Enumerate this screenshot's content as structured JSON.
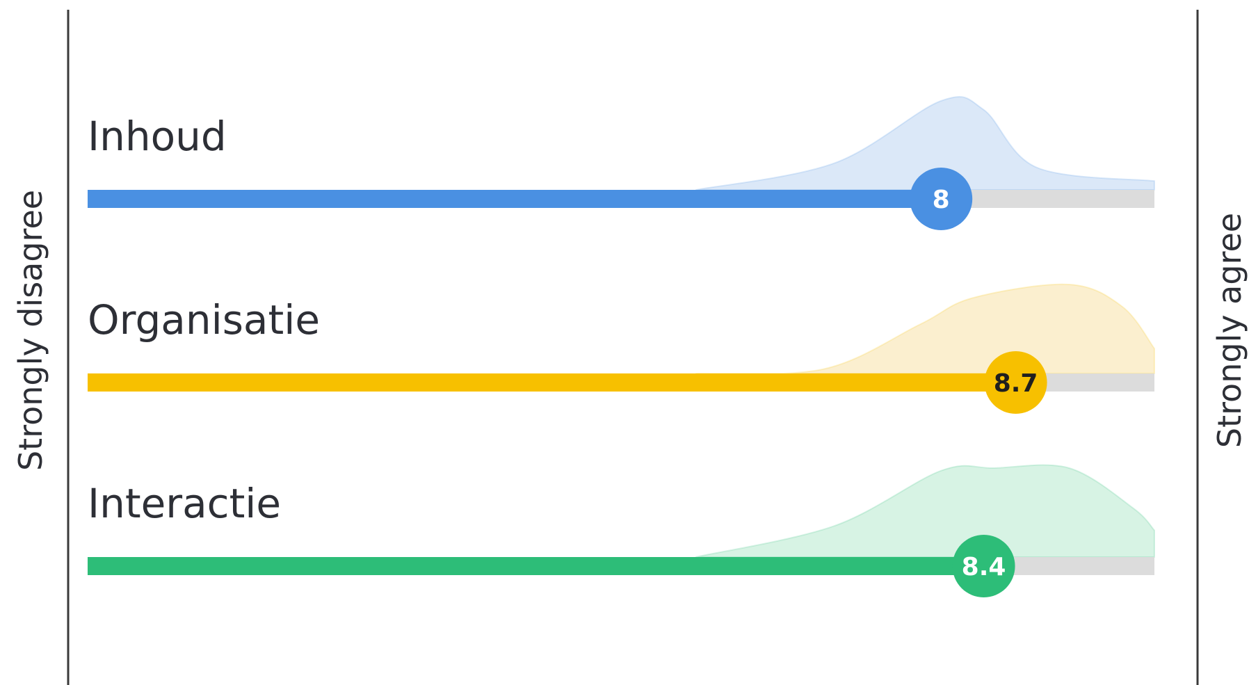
{
  "chart_data": {
    "type": "slider-distribution",
    "scale": {
      "min": 0,
      "max": 10
    },
    "axis_labels": {
      "left": "Strongly disagree",
      "right": "Strongly agree"
    },
    "series": [
      {
        "name": "Inhoud",
        "value": 8,
        "value_label": "8",
        "color": "#4a90e2",
        "area_color": "#dbe8f8",
        "text_color": "#ffffff",
        "distribution": [
          [
            5.7,
            0
          ],
          [
            7.0,
            0.3
          ],
          [
            8.0,
            1.0
          ],
          [
            8.4,
            0.9
          ],
          [
            8.9,
            0.25
          ],
          [
            10,
            0.1
          ]
        ]
      },
      {
        "name": "Organisatie",
        "value": 8.7,
        "value_label": "8.7",
        "color": "#f7c000",
        "area_color": "#fbefcf",
        "text_color": "#1f1f1f",
        "distribution": [
          [
            5.7,
            0
          ],
          [
            6.9,
            0.05
          ],
          [
            7.8,
            0.55
          ],
          [
            8.3,
            0.85
          ],
          [
            9.2,
            1.0
          ],
          [
            9.7,
            0.75
          ],
          [
            10,
            0.28
          ]
        ]
      },
      {
        "name": "Interactie",
        "value": 8.4,
        "value_label": "8.4",
        "color": "#2dbd78",
        "area_color": "#d7f3e4",
        "text_color": "#ffffff",
        "distribution": [
          [
            5.7,
            0
          ],
          [
            7.0,
            0.35
          ],
          [
            8.0,
            0.97
          ],
          [
            8.5,
            1.0
          ],
          [
            9.2,
            1.0
          ],
          [
            9.8,
            0.55
          ],
          [
            10,
            0.3
          ]
        ]
      }
    ]
  }
}
